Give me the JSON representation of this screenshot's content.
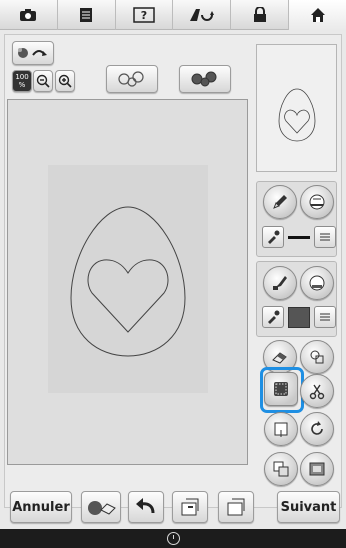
{
  "toolbar": {
    "items": [
      {
        "icon": "camera-icon",
        "glyph": "📷"
      },
      {
        "icon": "document-icon",
        "glyph": "🗎"
      },
      {
        "icon": "help-icon",
        "glyph": "?"
      },
      {
        "icon": "sewing-machine-icon",
        "glyph": "⚙"
      },
      {
        "icon": "lock-icon",
        "glyph": "🔒"
      },
      {
        "icon": "home-icon",
        "glyph": "⌂"
      }
    ]
  },
  "zoom": {
    "level_label": "100\n%"
  },
  "buttons": {
    "cancel_label": "Annuler",
    "next_label": "Suivant"
  },
  "colors": {
    "accent_highlight": "#1e8fe3",
    "fill_swatch": "#555555"
  }
}
